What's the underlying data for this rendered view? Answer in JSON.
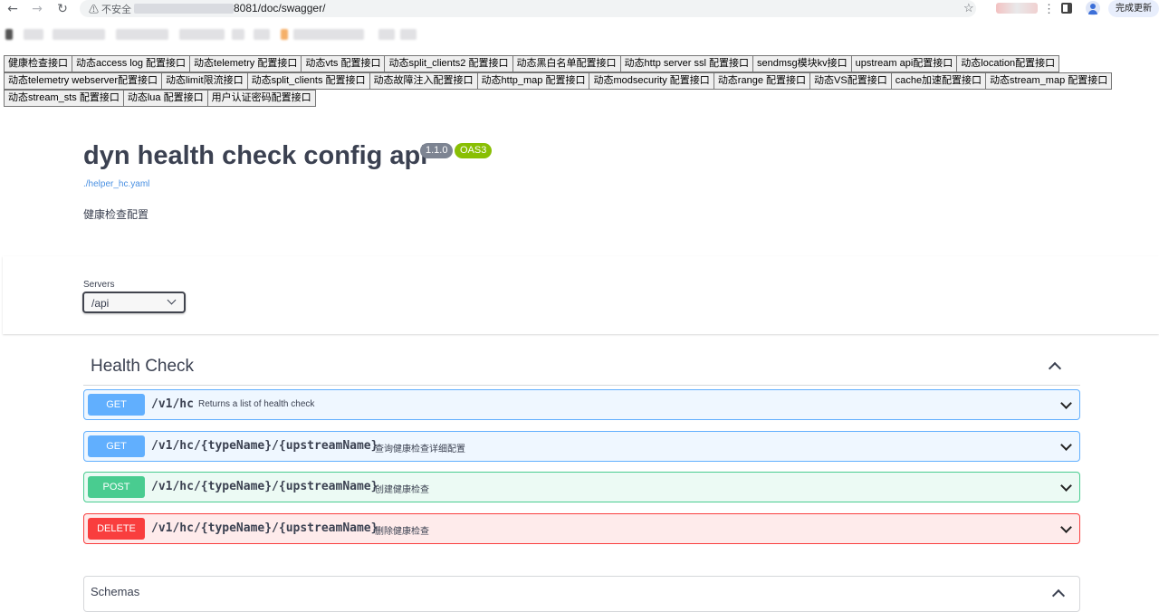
{
  "browser": {
    "url_warning": "⚠ 不安全",
    "url_path": "8081/doc/swagger/",
    "update_label": "完成更新"
  },
  "nav_buttons": {
    "row1": [
      "健康检查接口",
      "动态access log 配置接口",
      "动态telemetry 配置接口",
      "动态vts 配置接口",
      "动态split_clients2 配置接口",
      "动态黑白名单配置接口",
      "动态http server ssl 配置接口",
      "sendmsg模块kv接口",
      "upstream api配置接口",
      "动态location配置接口"
    ],
    "row2": [
      "动态telemetry webserver配置接口",
      "动态limit限流接口",
      "动态split_clients 配置接口",
      "动态故障注入配置接口",
      "动态http_map 配置接口",
      "动态modsecurity 配置接口",
      "动态range 配置接口",
      "动态VS配置接口",
      "cache加速配置接口",
      "动态stream_map 配置接口"
    ],
    "row3": [
      "动态stream_sts 配置接口",
      "动态lua 配置接口",
      "用户认证密码配置接口"
    ]
  },
  "info": {
    "title": "dyn health check config api",
    "version": "1.1.0",
    "oas": "OAS3",
    "spec_url": "./helper_hc.yaml",
    "description": "健康检查配置"
  },
  "servers": {
    "label": "Servers",
    "selected": "/api"
  },
  "tag": {
    "name": "Health Check"
  },
  "operations": [
    {
      "method": "GET",
      "path": "/v1/hc",
      "summary": "Returns a list of health check"
    },
    {
      "method": "GET",
      "path": "/v1/hc/{typeName}/{upstreamName}",
      "summary": "查询健康检查详细配置"
    },
    {
      "method": "POST",
      "path": "/v1/hc/{typeName}/{upstreamName}",
      "summary": "创建健康检查"
    },
    {
      "method": "DELETE",
      "path": "/v1/hc/{typeName}/{upstreamName}",
      "summary": "删除健康检查"
    }
  ],
  "schemas": {
    "title": "Schemas"
  },
  "colors": {
    "get": "#61affe",
    "post": "#49cc90",
    "delete": "#f93e3e",
    "version_badge": "#7d8492",
    "oas_badge": "#89bf04"
  }
}
